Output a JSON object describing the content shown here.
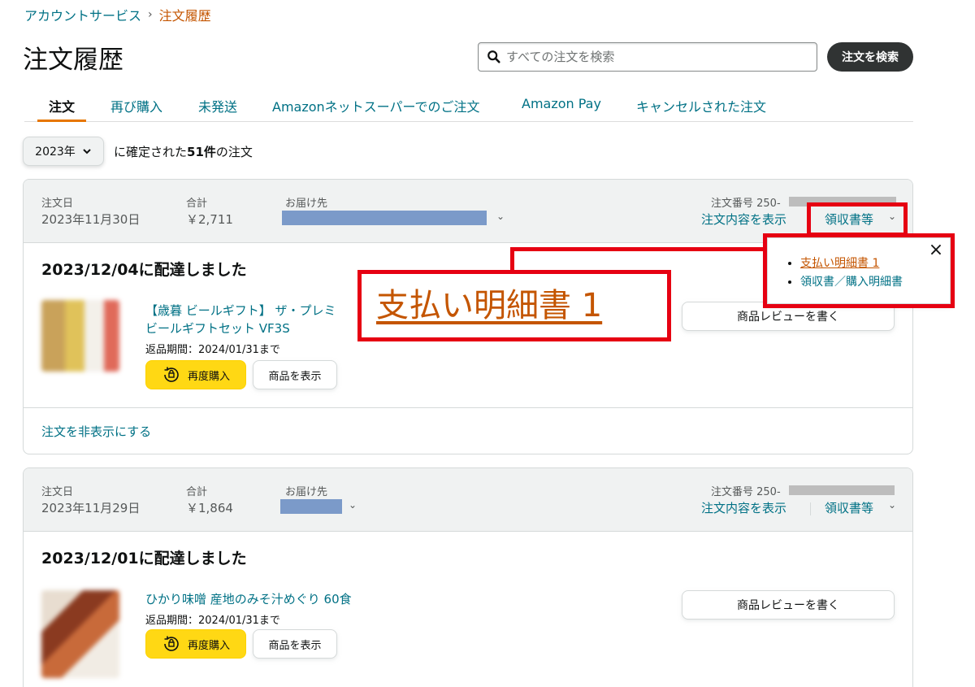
{
  "breadcrumb": {
    "parent": "アカウントサービス",
    "separator": "›",
    "current": "注文履歴"
  },
  "page_title": "注文履歴",
  "search": {
    "placeholder": "すべての注文を検索",
    "button_label": "注文を検索"
  },
  "tabs": [
    {
      "label": "注文",
      "active": true
    },
    {
      "label": "再び購入"
    },
    {
      "label": "未発送"
    },
    {
      "label": "Amazonネットスーパーでのご注文"
    },
    {
      "label": "Amazon Pay"
    },
    {
      "label": "キャンセルされた注文"
    }
  ],
  "filter": {
    "year": "2023年",
    "text_prefix": "に確定された",
    "count": "51件",
    "text_suffix": "の注文"
  },
  "orders": [
    {
      "order_date_label": "注文日",
      "order_date": "2023年11月30日",
      "total_label": "合計",
      "total": "￥2,711",
      "ship_to_label": "お届け先",
      "order_no_label": "注文番号 250-",
      "details_link": "注文内容を表示",
      "receipt_link": "領収書等",
      "delivered": "2023/12/04に配達しました",
      "product_title_1": "【歳暮 ビールギフト】 ザ・プレミ",
      "product_title_2": "ビールギフトセット VF3S",
      "return_text": "返品期間：2024/01/31まで",
      "buy_again": "再度購入",
      "view_item": "商品を表示",
      "review": "商品レビューを書く",
      "hide_order": "注文を非表示にする"
    },
    {
      "order_date_label": "注文日",
      "order_date": "2023年11月29日",
      "total_label": "合計",
      "total": "￥1,864",
      "ship_to_label": "お届け先",
      "order_no_label": "注文番号 250-",
      "details_link": "注文内容を表示",
      "receipt_link": "領収書等",
      "delivered": "2023/12/01に配達しました",
      "product_title_1": "ひかり味噌 産地のみそ汁めぐり 60食",
      "return_text": "返品期間：2024/01/31まで",
      "buy_again": "再度購入",
      "view_item": "商品を表示",
      "review": "商品レビューを書く"
    }
  ],
  "popover": {
    "items": [
      "支払い明細書 1",
      "領収書／購入明細書"
    ],
    "close": "×"
  },
  "callout": {
    "text": "支払い明細書 1"
  },
  "colors": {
    "link": "#007185",
    "accent_orange": "#c45500",
    "annotation_red": "#e60012",
    "buy_again_yellow": "#ffd814"
  }
}
